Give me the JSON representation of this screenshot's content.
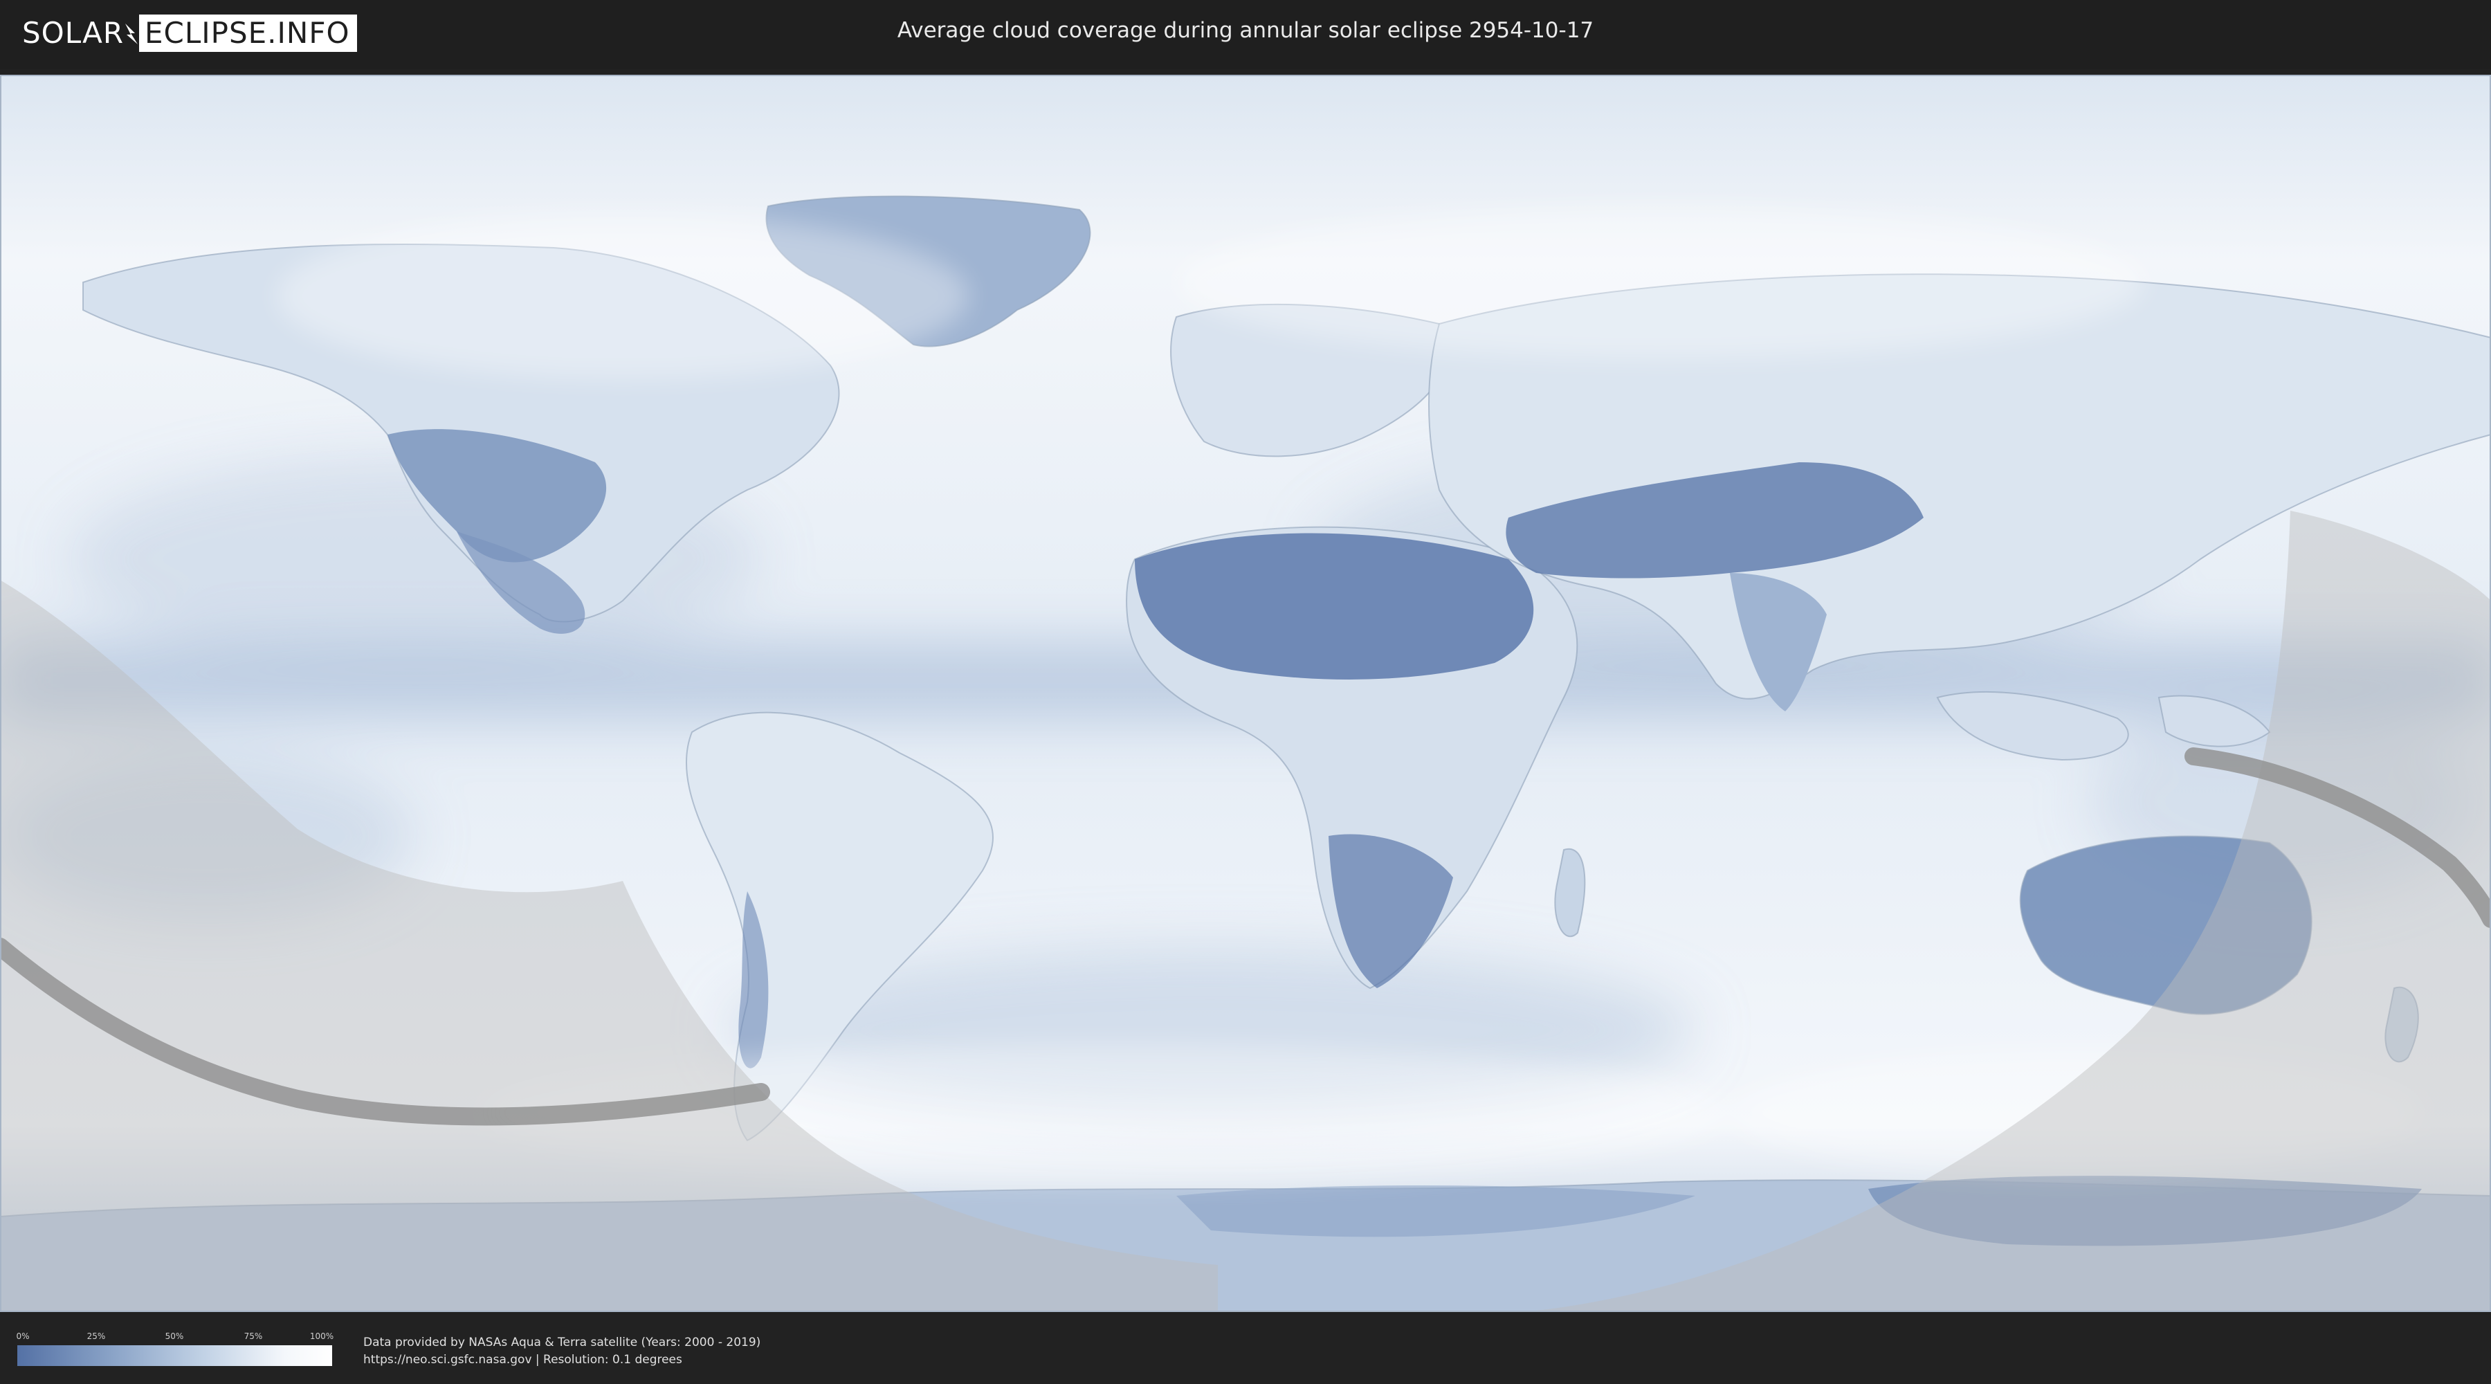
{
  "header": {
    "logo_left": "SOLAR",
    "logo_right": "ECLIPSE.INFO",
    "title": "Average cloud coverage during annular solar eclipse 2954-10-17"
  },
  "legend": {
    "ticks": [
      "0%",
      "25%",
      "50%",
      "75%",
      "100%"
    ],
    "colors": {
      "low": "#5471a5",
      "high": "#ffffff"
    }
  },
  "credits": {
    "line1": "Data provided by NASAs Aqua & Terra satellite (Years: 2000 - 2019)",
    "line2": "https://neo.sci.gsfc.nasa.gov | Resolution: 0.1 degrees"
  },
  "map": {
    "colors": {
      "cloud_clear": "#5a77aa",
      "cloud_full": "#ffffff",
      "eclipse_overlay": "#bfbfbf",
      "eclipse_path": "#8f8f8f"
    }
  }
}
